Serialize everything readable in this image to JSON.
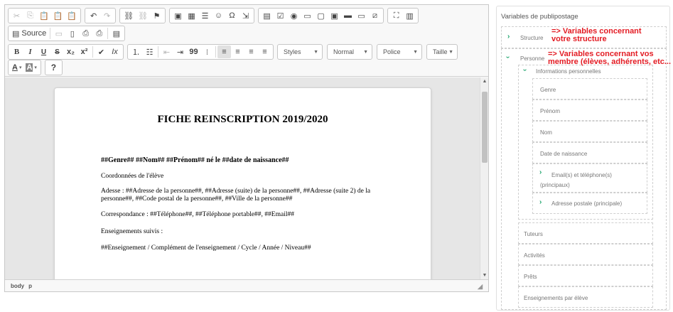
{
  "toolbar": {
    "source_label": "Source",
    "styles_label": "Styles",
    "format_label": "Normal",
    "font_label": "Police",
    "size_label": "Taille",
    "help_label": "?"
  },
  "document": {
    "title": "FICHE REINSCRIPTION 2019/2020",
    "line1": "##Genre##  ##Nom##  ##Prénom## né le ##date de naissance##",
    "line2": "Coordonnées de l'élève",
    "line3": "Adesse :   ##Adresse de la personne##, ##Adresse (suite) de la personne##, ##Adresse (suite 2) de la personne##, ##Code postal de la personne##, ##Ville de la personne##",
    "line4": "Correspondance : ##Téléphone##, ##Téléphone portable##, ##Email##",
    "line5": "Enseignements suivis :",
    "line6": "##Enseignement / Complément de l'enseignement / Cycle / Année / Niveau##"
  },
  "statusbar": {
    "path1": "body",
    "path2": "p"
  },
  "annotations": {
    "structure": "=> Variables concernant\nvotre structure",
    "personne": "=> Variables concernant vos\nmembre (élèves, adhérents, etc..."
  },
  "panel": {
    "title": "Variables de publipostage",
    "structure": "Structure",
    "personne": "Personne",
    "infos": "Informations personnelles",
    "genre": "Genre",
    "prenom": "Prénom",
    "nom": "Nom",
    "date_naissance": "Date de naissance",
    "email_tel": "Email(s) et téléphone(s) (principaux)",
    "adresse": "Adresse postale (principale)",
    "tuteurs": "Tuteurs",
    "activites": "Activités",
    "prets": "Prêts",
    "enseignements": "Enseignements par élève"
  },
  "colors": {
    "accent_green": "#1aa36b",
    "annotation_red": "#e31b23"
  }
}
